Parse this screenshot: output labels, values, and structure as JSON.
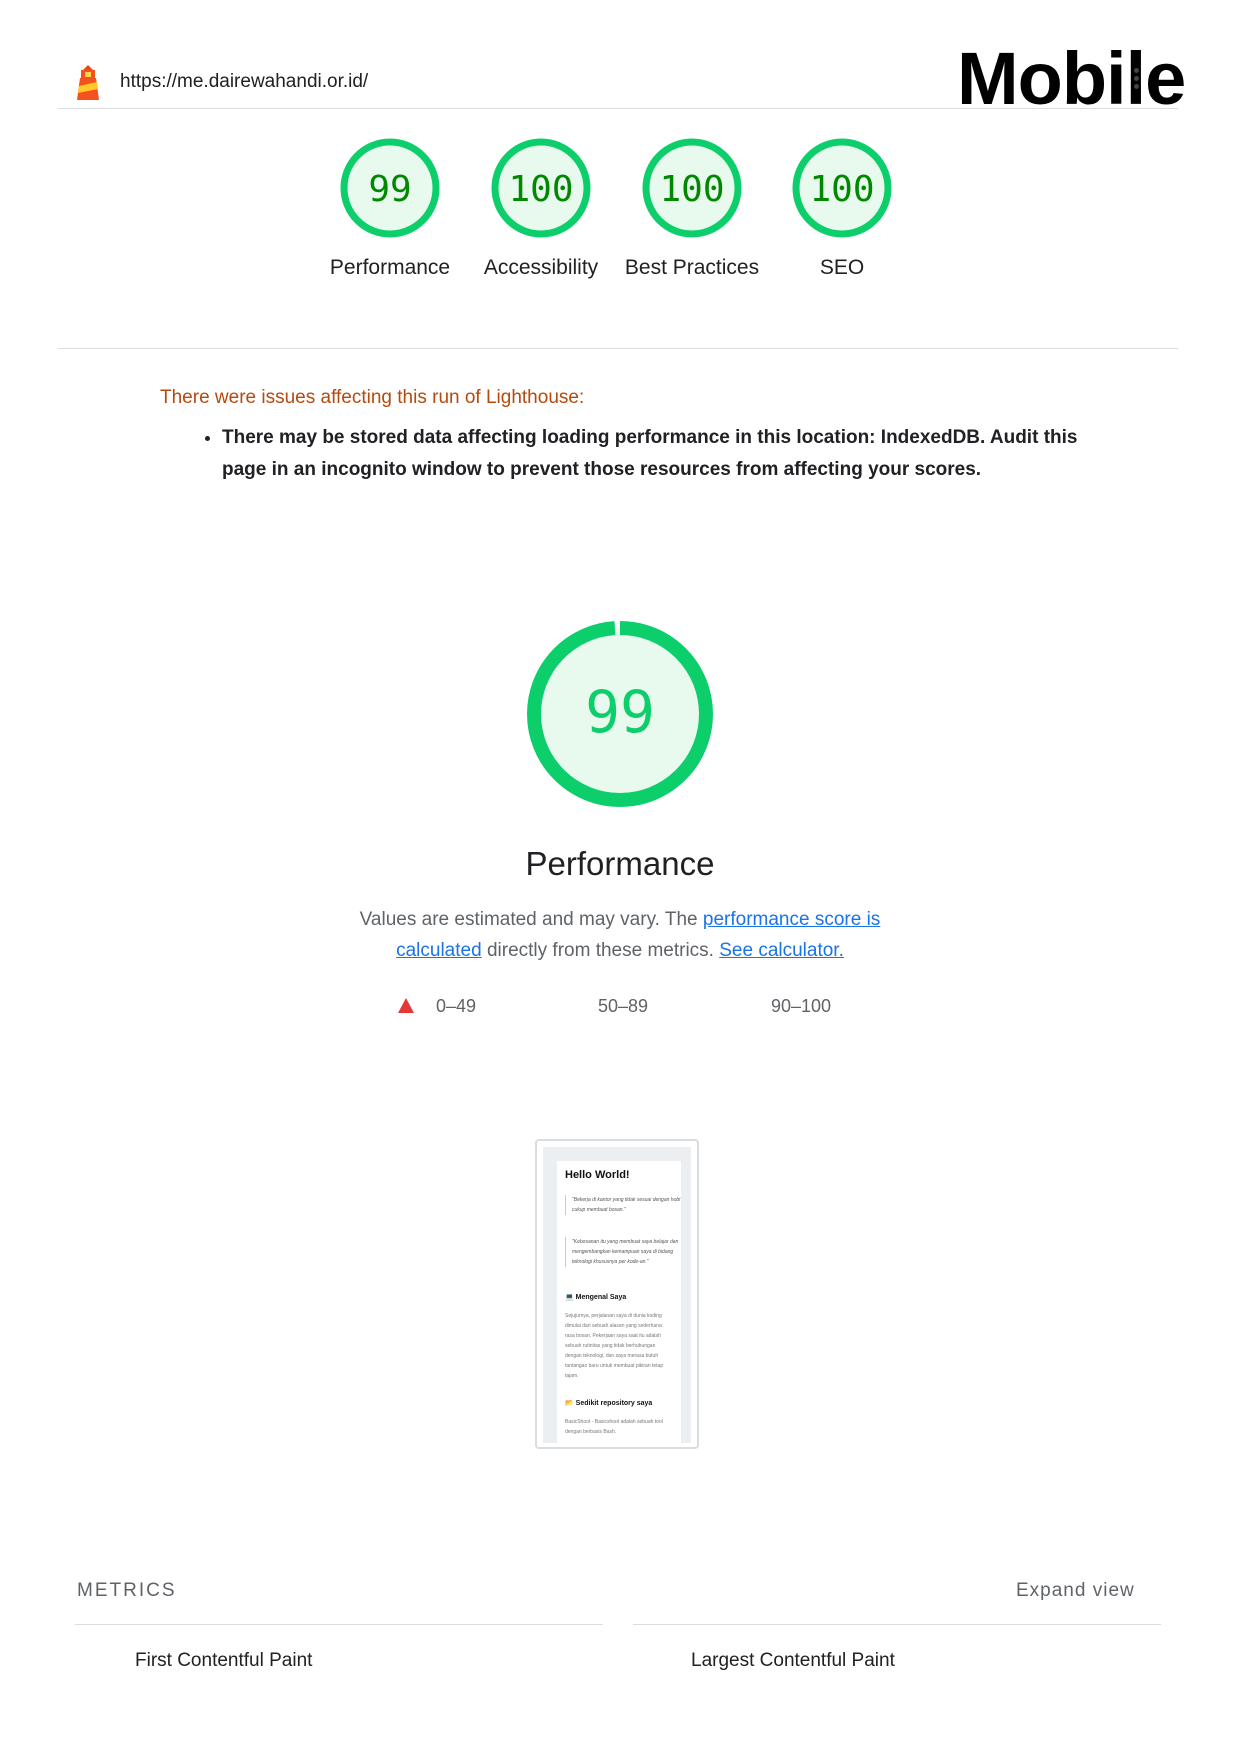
{
  "header": {
    "url": "https://me.dairewahandi.or.id/",
    "device_label": "Mobile"
  },
  "colors": {
    "pass": "#0cce6b",
    "pass_text": "#008800",
    "pass_bg": "#e8f9ee",
    "warning_text": "#b54a0e",
    "fail": "#e53935",
    "link": "#1a73e8"
  },
  "categories": [
    {
      "score": "99",
      "label": "Performance",
      "fraction": 0.99
    },
    {
      "score": "100",
      "label": "Accessibility",
      "fraction": 1.0
    },
    {
      "score": "100",
      "label": "Best Practices",
      "fraction": 1.0
    },
    {
      "score": "100",
      "label": "SEO",
      "fraction": 1.0
    }
  ],
  "warnings": {
    "title": "There were issues affecting this run of Lighthouse:",
    "items": [
      "There may be stored data affecting loading performance in this location: IndexedDB. Audit this page in an incognito window to prevent those resources from affecting your scores."
    ]
  },
  "performance": {
    "score": "99",
    "fraction": 0.99,
    "title": "Performance",
    "desc_prefix": "Values are estimated and may vary. The ",
    "desc_link1": "performance score is calculated",
    "desc_middle": " directly from these metrics. ",
    "desc_link2": "See calculator."
  },
  "legend": {
    "fail": "0–49",
    "average": "50–89",
    "pass": "90–100"
  },
  "screenshot": {
    "heading": "Hello World!",
    "quote1": "\"Bekerja di kantor yang tidak sesuai dengan hobi cukup membuat bosan.\"",
    "quote2": "\"Kebosanan itu yang membuat saya belajar dan mengembangkan kemampuan saya di bidang teknologi khususnya per kode-an.\"",
    "section1": "💻 Mengenal Saya",
    "para1": "Sejujurnya, perjalanan saya di dunia koding dimulai dari sebuah alasan yang sederhana: rasa bosan. Pekerjaan saya saat itu adalah sebuah rutinitas yang tidak berhubungan dengan teknologi, dan saya merasa butuh tantangan baru untuk membuat pikiran tetap tajam.",
    "section2": "📂 Sedikit repository saya",
    "para2": "BasicShoot - Basicshoot adalah sebuah tool dengan berbasis Bash."
  },
  "metrics": {
    "heading": "METRICS",
    "expand_label": "Expand view",
    "items": [
      "First Contentful Paint",
      "Largest Contentful Paint"
    ]
  }
}
